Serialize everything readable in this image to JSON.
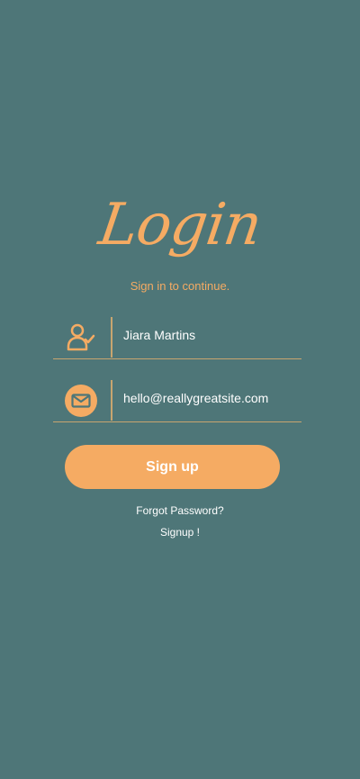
{
  "login": {
    "title": "Login",
    "subtitle": "Sign in to continue.",
    "fields": {
      "name": {
        "value": "Jiara Martins",
        "icon": "user-check-icon"
      },
      "email": {
        "value": "hello@reallygreatsite.com",
        "icon": "mail-icon"
      }
    },
    "button_label": "Sign up",
    "forgot_password": "Forgot Password?",
    "signup_link": "Signup !"
  },
  "colors": {
    "background": "#4e7678",
    "accent": "#f5ab63",
    "text": "#ffffff",
    "line": "#c8a56f"
  }
}
